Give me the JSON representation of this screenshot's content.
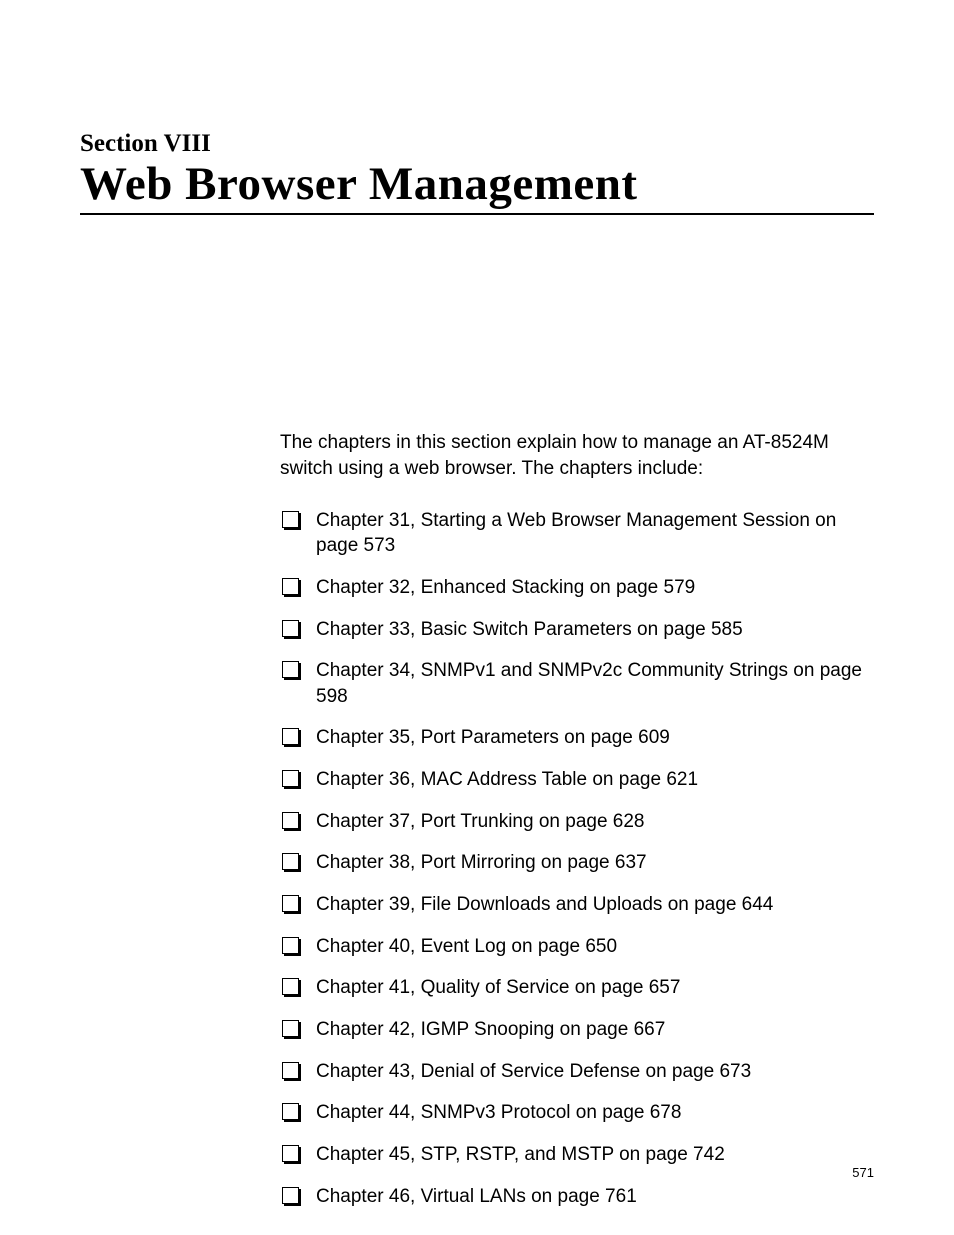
{
  "sectionLabel": "Section VIII",
  "title": "Web Browser Management",
  "intro": "The chapters in this section explain how to manage an AT-8524M switch using a web browser. The chapters include:",
  "items": [
    "Chapter 31, Starting a Web Browser Management Session on page 573",
    "Chapter 32, Enhanced Stacking on page 579",
    "Chapter 33, Basic Switch Parameters on page 585",
    "Chapter 34, SNMPv1 and SNMPv2c Community Strings on page 598",
    "Chapter 35, Port Parameters on page 609",
    "Chapter 36, MAC Address Table on page 621",
    "Chapter 37, Port Trunking on page 628",
    "Chapter 38, Port Mirroring on page 637",
    "Chapter 39, File Downloads and Uploads on page 644",
    "Chapter 40, Event Log on page 650",
    "Chapter 41, Quality of Service on page 657",
    "Chapter 42, IGMP Snooping on page 667",
    "Chapter 43, Denial of Service Defense on page 673",
    "Chapter 44, SNMPv3 Protocol on page 678",
    "Chapter 45, STP, RSTP, and MSTP on page 742",
    "Chapter 46, Virtual LANs on page 761"
  ],
  "pageNumber": "571"
}
